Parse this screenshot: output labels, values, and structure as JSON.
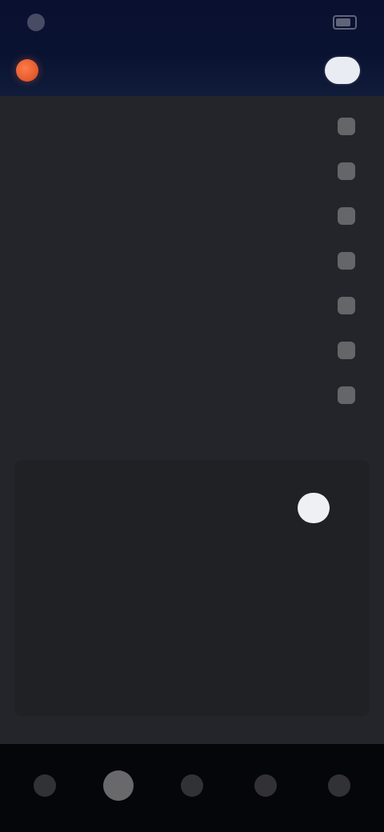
{
  "status": {
    "time": "",
    "icons": ""
  },
  "header": {
    "title": "",
    "action_label": ""
  },
  "list": {
    "items": [
      {
        "label": "",
        "value": ""
      },
      {
        "label": "",
        "value": ""
      },
      {
        "label": "",
        "value": ""
      },
      {
        "label": "",
        "value": ""
      },
      {
        "label": "",
        "value": ""
      },
      {
        "label": "",
        "value": ""
      },
      {
        "label": "",
        "value": ""
      }
    ],
    "more_label": ""
  },
  "section": {
    "label": "",
    "segments": {
      "active": "",
      "inactive": ""
    }
  },
  "bottom_actions": {
    "left": "",
    "center": "",
    "right": ""
  },
  "nav": {
    "items": [
      {
        "label": ""
      },
      {
        "label": ""
      },
      {
        "label": ""
      },
      {
        "label": ""
      },
      {
        "label": ""
      }
    ]
  },
  "colors": {
    "header_bg": "#0a1232",
    "panel_bg": "#23252a",
    "accent": "#ff7b4a"
  },
  "icons": {
    "logo": "logo-icon",
    "battery": "battery-icon",
    "toggle": "toggle-icon",
    "nav": "nav-icon"
  }
}
